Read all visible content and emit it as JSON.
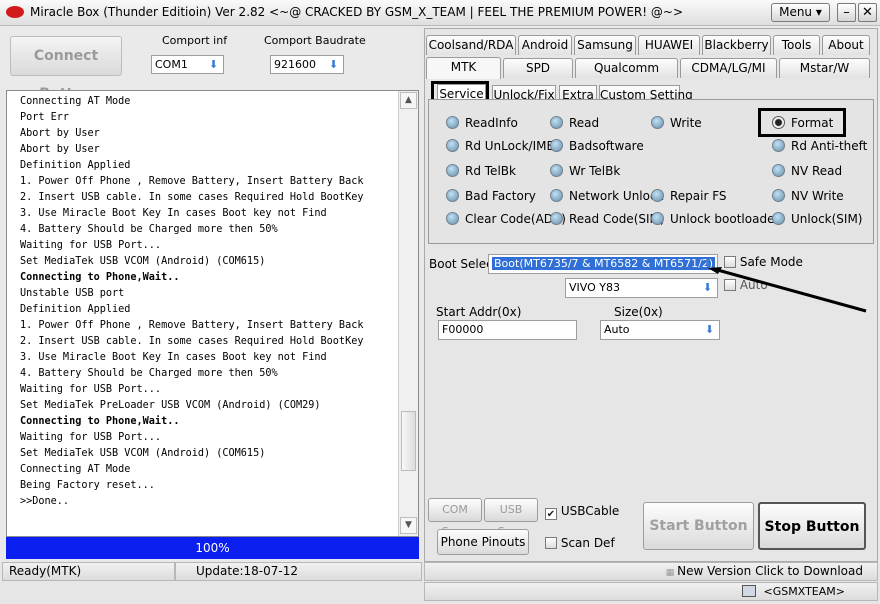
{
  "window": {
    "title": "Miracle Box (Thunder Editioin) Ver 2.82 <~@ CRACKED BY GSM_X_TEAM | FEEL THE PREMIUM POWER! @~>",
    "menu_label": "Menu",
    "minimize": "–",
    "close": "✕"
  },
  "connection": {
    "connect_button": "Connect Button",
    "comport_label": "Comport inf",
    "comport_value": "COM1",
    "baud_label": "Comport Baudrate",
    "baud_value": "921600"
  },
  "log": {
    "lines": [
      {
        "text": "Connecting AT Mode",
        "bold": false
      },
      {
        "text": "Port Err",
        "bold": false
      },
      {
        "text": "Abort by User",
        "bold": false
      },
      {
        "text": "Abort by User",
        "bold": false
      },
      {
        "text": "Definition Applied",
        "bold": false
      },
      {
        "text": "1. Power Off Phone , Remove Battery, Insert Battery Back",
        "bold": false
      },
      {
        "text": "2. Insert USB cable. In some cases Required Hold BootKey",
        "bold": false
      },
      {
        "text": "3. Use Miracle Boot Key In cases Boot key not Find",
        "bold": false
      },
      {
        "text": "4. Battery Should be Charged more then 50%",
        "bold": false
      },
      {
        "text": "Waiting for USB Port...",
        "bold": false
      },
      {
        "text": "Set MediaTek USB VCOM (Android) (COM615)",
        "bold": false
      },
      {
        "text": "Connecting to Phone,Wait..",
        "bold": true
      },
      {
        "text": "Unstable USB port",
        "bold": false
      },
      {
        "text": "Definition Applied",
        "bold": false
      },
      {
        "text": "1. Power Off Phone , Remove Battery, Insert Battery Back",
        "bold": false
      },
      {
        "text": "2. Insert USB cable. In some cases Required Hold BootKey",
        "bold": false
      },
      {
        "text": "3. Use Miracle Boot Key In cases Boot key not Find",
        "bold": false
      },
      {
        "text": "4. Battery Should be Charged more then 50%",
        "bold": false
      },
      {
        "text": "Waiting for USB Port...",
        "bold": false
      },
      {
        "text": "Set MediaTek PreLoader USB VCOM (Android) (COM29)",
        "bold": false
      },
      {
        "text": "Connecting to Phone,Wait..",
        "bold": true
      },
      {
        "text": "Waiting for USB Port...",
        "bold": false
      },
      {
        "text": "Set MediaTek USB VCOM (Android) (COM615)",
        "bold": false
      },
      {
        "text": "Connecting AT Mode",
        "bold": false
      },
      {
        "text": "Being Factory reset...",
        "bold": false
      },
      {
        "text": ">>Done..",
        "bold": false
      }
    ]
  },
  "progress": {
    "value": 1.0,
    "label": "100%"
  },
  "tabs_row1": [
    "Coolsand/RDA",
    "Android",
    "Samsung",
    "HUAWEI",
    "Blackberry",
    "Tools",
    "About"
  ],
  "tabs_row2": [
    "MTK",
    "SPD",
    "Qualcomm",
    "CDMA/LG/MI",
    "Mstar/W"
  ],
  "subtabs": [
    "Service",
    "Unlock/Fix",
    "Extra",
    "Custom Setting"
  ],
  "options": {
    "col1": [
      "ReadInfo",
      "Rd UnLock/IMEI",
      "Rd TelBk",
      "Bad Factory",
      "Clear Code(ADB)"
    ],
    "col2": [
      "Read",
      "Badsoftware",
      "Wr TelBk",
      "Network Unlock",
      "Read Code(SIM)"
    ],
    "col3": [
      "Write",
      "Repair FS",
      "Unlock bootloader"
    ],
    "col4": [
      "Format",
      "Rd Anti-theft",
      "NV Read",
      "NV Write",
      "Unlock(SIM)"
    ]
  },
  "boot": {
    "label": "Boot Select:",
    "value": "Boot(MT6735/7 & MT6582 & MT6571/2)",
    "model": "VIVO Y83",
    "safe_mode": "Safe Mode",
    "auto": "Auto"
  },
  "addr": {
    "start_label": "Start Addr(0x)",
    "start_value": "F00000",
    "size_label": "Size(0x)",
    "size_value": "Auto"
  },
  "bottom": {
    "com_scan": "COM Scan",
    "usb_scan": "USB Scan",
    "usb_cable": "USBCable",
    "phone_pinouts": "Phone Pinouts",
    "scan_def": "Scan Def",
    "start_button": "Start Button",
    "stop_button": "Stop Button"
  },
  "status": {
    "mode": "Ready(MTK)",
    "update": "Update:18-07-12",
    "new_version": "New Version Click to Download",
    "team": "<GSMXTEAM>"
  },
  "colors": {
    "progress": "#0b1ff0",
    "selection": "#2f6fd6"
  }
}
